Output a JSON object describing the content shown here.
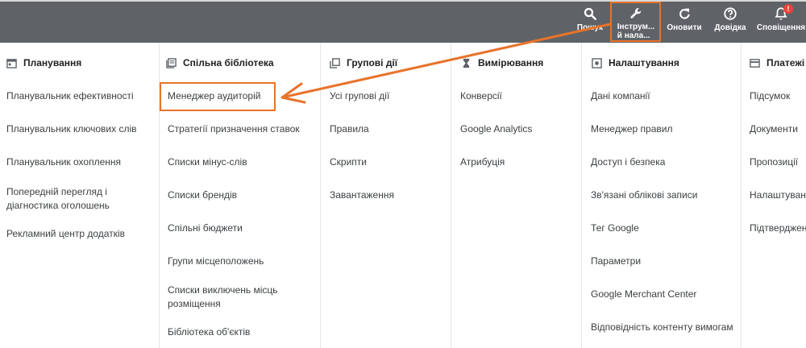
{
  "toolbar": {
    "search_label": "Пошук",
    "tools_label": "Інструм...\nй нала...",
    "refresh_label": "Оновити",
    "help_label": "Довідка",
    "notifications_label": "Сповіщення",
    "notifications_badge": "!"
  },
  "columns": [
    {
      "title": "Планування",
      "icon": "calendar-icon",
      "items": [
        "Планувальник ефективності",
        "Планувальник ключових слів",
        "Планувальник охоплення",
        "Попередній перегляд і\nдіагностика оголошень",
        "Рекламний центр додатків"
      ]
    },
    {
      "title": "Спільна бібліотека",
      "icon": "library-icon",
      "items": [
        "Менеджер аудиторій",
        "Стратегії призначення ставок",
        "Списки мінус-слів",
        "Списки брендів",
        "Спільні бюджети",
        "Групи місцеположень",
        "Списки виключень місць\nрозміщення",
        "Бібліотека об'єктів"
      ]
    },
    {
      "title": "Групові дії",
      "icon": "bulk-actions-icon",
      "items": [
        "Усі групові дії",
        "Правила",
        "Скрипти",
        "Завантаження"
      ]
    },
    {
      "title": "Вимірювання",
      "icon": "hourglass-icon",
      "items": [
        "Конверсії",
        "Google Analytics",
        "Атрибуція"
      ]
    },
    {
      "title": "Налаштування",
      "icon": "settings-icon",
      "items": [
        "Дані компанії",
        "Менеджер правил",
        "Доступ і безпека",
        "Зв'язані облікові записи",
        "Тег Google",
        "Параметри",
        "Google Merchant Center",
        "Відповідність контенту вимогам"
      ]
    },
    {
      "title": "Платежі",
      "icon": "credit-card-icon",
      "items": [
        "Підсумок",
        "Документи",
        "Пропозиції",
        "Налаштування",
        "Підтвердження"
      ]
    }
  ],
  "colors": {
    "toolbar_bg": "#5f6368",
    "annotation": "#e8732a",
    "badge": "#e8453c"
  }
}
